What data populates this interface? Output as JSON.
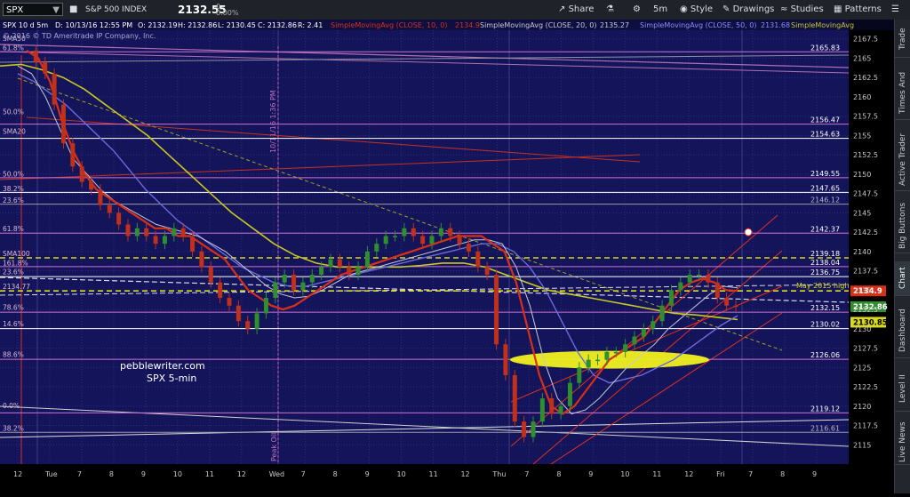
{
  "toolbar": {
    "symbol": "SPX",
    "description": "S&P 500 INDEX",
    "last_price": "2132.55",
    "change": "0",
    "change_pct": "0.00%",
    "share_label": "Share",
    "interval": "5m",
    "style_label": "Style",
    "drawings_label": "Drawings",
    "studies_label": "Studies",
    "patterns_label": "Patterns"
  },
  "side_tabs": [
    "Trade",
    "Times And Sales",
    "Active Trader",
    "Big Buttons",
    "Chart",
    "Dashboard",
    "Level II",
    "Live News"
  ],
  "side_active": "Chart",
  "header": {
    "line1_symbol": "SPX 10 d 5m",
    "line1_ohlc": "D: 10/13/16 12:55 PM",
    "open": "O: 2132.19",
    "high": "H: 2132.86",
    "low": "L: 2130.45",
    "close": "C: 2132.86",
    "range": "R: 2.41",
    "sma10": "SimpleMovingAvg (CLOSE, 10, 0)",
    "sma10_val": "2134.9",
    "sma20": "SimpleMovingAvg (CLOSE, 20, 0)",
    "sma20_val": "2135.27",
    "sma50": "SimpleMovingAvg (CLOSE, 50, 0)",
    "sma50_val": "2131.68",
    "sma100": "SimpleMovingAvg",
    "copyright": "© 2016 © TD Ameritrade IP Company, Inc."
  },
  "annotations": {
    "watermark1": "pebblewriter.com",
    "watermark2": "SPX 5-min",
    "peak_oil": "Peak Oil",
    "date_marker": "10/11/16 1:36 PM",
    "may_high": "May 2015 high"
  },
  "colors": {
    "background": "#14145a",
    "price_up": "#2f8f2f",
    "price_down": "#c0301a",
    "sma10": "#d83018",
    "sma20": "#c8c8d8",
    "sma50": "#6b6bdc",
    "sma100": "#c8c820",
    "fib": "#d070d0",
    "highlight": "#f0f020"
  },
  "chart_data": {
    "type": "line",
    "title": "SPX 10 d 5m",
    "ylim": [
      2112.5,
      2170
    ],
    "y_ticks": [
      "2167.5",
      "2165",
      "2162.5",
      "2160",
      "2157.5",
      "2155",
      "2152.5",
      "2150",
      "2147.5",
      "2145",
      "2142.5",
      "2140",
      "2137.5",
      "2135",
      "2132.5",
      "2130",
      "2127.5",
      "2125",
      "2122.5",
      "2120",
      "2117.5",
      "2115"
    ],
    "x_tick_labels": [
      "12",
      "Tue",
      "7",
      "8",
      "9",
      "10",
      "11",
      "12",
      "Wed",
      "7",
      "8",
      "9",
      "10",
      "11",
      "12",
      "Thu",
      "7",
      "8",
      "9",
      "10",
      "11",
      "12",
      "Fri",
      "7",
      "8",
      "9"
    ],
    "series": [
      {
        "name": "SimpleMovingAvg (CLOSE, 10, 0)",
        "color": "#d83018"
      },
      {
        "name": "SimpleMovingAvg (CLOSE, 20, 0)",
        "color": "#c8c8d8"
      },
      {
        "name": "SimpleMovingAvg (CLOSE, 50, 0)",
        "color": "#6b6bdc"
      },
      {
        "name": "SimpleMovingAvg",
        "color": "#c8c820"
      }
    ],
    "price_path": [
      2166,
      2164.5,
      2163,
      2159,
      2154,
      2151,
      2149,
      2148,
      2146,
      2145,
      2143.5,
      2142,
      2143,
      2142,
      2141,
      2142,
      2143,
      2142,
      2140,
      2138,
      2136,
      2134,
      2133,
      2131,
      2130,
      2132,
      2134,
      2136,
      2137,
      2135,
      2136,
      2137,
      2138,
      2139,
      2138,
      2137,
      2138,
      2140,
      2141,
      2142,
      2142,
      2143,
      2142,
      2141,
      2142,
      2143,
      2142,
      2141,
      2140,
      2138,
      2137,
      2128,
      2124,
      2118,
      2116,
      2118,
      2121,
      2119,
      2120,
      2123,
      2125,
      2126,
      2126,
      2127,
      2127,
      2128,
      2129,
      2130,
      2131,
      2133,
      2135,
      2136,
      2137,
      2137,
      2136,
      2134,
      2133,
      2132.9
    ],
    "sma10_path": [
      2166,
      2165,
      2162,
      2157,
      2153,
      2150,
      2148,
      2147,
      2146,
      2145,
      2144,
      2143,
      2143,
      2142,
      2142,
      2141,
      2140,
      2139,
      2137,
      2135,
      2134,
      2133,
      2132.5,
      2133,
      2134,
      2135,
      2136,
      2137,
      2137.5,
      2138,
      2138.5,
      2139,
      2139.5,
      2140,
      2140.5,
      2141,
      2141.5,
      2142,
      2142,
      2142,
      2141,
      2140,
      2136,
      2130,
      2124,
      2120,
      2119,
      2120,
      2122,
      2124,
      2126,
      2127,
      2128,
      2129,
      2131,
      2133,
      2135,
      2136,
      2136.5,
      2136,
      2135,
      2134.9
    ],
    "sma20_path": [
      2164,
      2163,
      2160,
      2156,
      2152,
      2150,
      2148,
      2146.5,
      2145.5,
      2144.5,
      2143.5,
      2143,
      2142.5,
      2142,
      2141,
      2140,
      2138.5,
      2137,
      2135.5,
      2134.5,
      2134,
      2134.2,
      2135,
      2136,
      2137,
      2137.5,
      2138,
      2138.5,
      2139,
      2139.5,
      2140,
      2140.5,
      2141,
      2141.5,
      2141.5,
      2141,
      2138,
      2133,
      2126,
      2121,
      2119,
      2119.5,
      2121,
      2123,
      2125,
      2126.5,
      2128,
      2130,
      2131.5,
      2133,
      2134.5,
      2135.5,
      2135.3
    ],
    "sma50_path": [
      2163,
      2162,
      2160.5,
      2159,
      2157,
      2155,
      2153,
      2150.5,
      2148,
      2146,
      2144,
      2142.5,
      2141,
      2139.5,
      2138,
      2137,
      2136,
      2135.5,
      2135.5,
      2136,
      2136.5,
      2137,
      2137.5,
      2138,
      2138.5,
      2139,
      2139.5,
      2140,
      2140.5,
      2141,
      2141,
      2140,
      2138,
      2135,
      2131,
      2127,
      2124,
      2123,
      2123.5,
      2124,
      2125,
      2126,
      2127.5,
      2129,
      2130.5,
      2131.7
    ],
    "sma100_path": [
      2164,
      2164.2,
      2163.5,
      2162.5,
      2161,
      2159,
      2157,
      2155,
      2152.5,
      2150,
      2147.5,
      2145,
      2143,
      2141,
      2139.5,
      2138.5,
      2138,
      2138,
      2138,
      2138,
      2138.2,
      2138.5,
      2138.5,
      2138,
      2137,
      2136,
      2135,
      2134.5,
      2134,
      2133.5,
      2133,
      2132.5,
      2132,
      2131.8,
      2131.5,
      2131.2
    ],
    "horizontal_levels": [
      {
        "label": "2165.83",
        "value": 2165.83,
        "color": "#d070d0"
      },
      {
        "label": "2156.47",
        "value": 2156.47,
        "color": "#d070d0"
      },
      {
        "label": "2154.63",
        "value": 2154.63,
        "color": "#ffffff"
      },
      {
        "label": "2149.55",
        "value": 2149.55,
        "color": "#d070d0"
      },
      {
        "label": "2147.65",
        "value": 2147.65,
        "color": "#ffffff"
      },
      {
        "label": "2146.12",
        "value": 2146.12,
        "color": "#9a9aa8"
      },
      {
        "label": "2142.37",
        "value": 2142.37,
        "color": "#d070d0"
      },
      {
        "label": "2139.18",
        "value": 2139.18,
        "color": "#d8d820"
      },
      {
        "label": "2138.04",
        "value": 2138.04,
        "color": "#d070d0"
      },
      {
        "label": "2136.75",
        "value": 2136.75,
        "color": "#ffffff"
      },
      {
        "label": "May 2015 high",
        "value": 2134.9,
        "color": "#d8d820"
      },
      {
        "label": "2132.15",
        "value": 2132.15,
        "color": "#d070d0"
      },
      {
        "label": "2130.02",
        "value": 2130.02,
        "color": "#ffffff"
      },
      {
        "label": "2126.06",
        "value": 2126.06,
        "color": "#d070d0"
      },
      {
        "label": "2119.12",
        "value": 2119.12,
        "color": "#d070d0"
      },
      {
        "label": "2116.61",
        "value": 2116.61,
        "color": "#9a9aa8"
      }
    ],
    "left_labels": [
      {
        "label": "SMA50",
        "value": 2167
      },
      {
        "label": "61.8%",
        "value": 2165.8
      },
      {
        "label": "50.0%",
        "value": 2157.5
      },
      {
        "label": "SMA20",
        "value": 2155
      },
      {
        "label": "50.0%",
        "value": 2149.5
      },
      {
        "label": "38.2%",
        "value": 2147.6
      },
      {
        "label": "23.6%",
        "value": 2146.1
      },
      {
        "label": "61.8%",
        "value": 2142.4
      },
      {
        "label": "SMA100",
        "value": 2139.2
      },
      {
        "label": "161.8%",
        "value": 2138
      },
      {
        "label": "23.6%",
        "value": 2136.8
      },
      {
        "label": "2134.77",
        "value": 2134.9
      },
      {
        "label": "78.6%",
        "value": 2132.2
      },
      {
        "label": "14.6%",
        "value": 2130.1
      },
      {
        "label": "88.6%",
        "value": 2126.1
      },
      {
        "label": "0.0%",
        "value": 2119.5
      },
      {
        "label": "38.2%",
        "value": 2116.6
      }
    ],
    "price_tags": [
      {
        "label": "2134.9",
        "value": 2134.9,
        "color": "#d83018"
      },
      {
        "label": "2132.86",
        "value": 2132.86,
        "color": "#2f8f2f"
      },
      {
        "label": "2130.85",
        "value": 2130.85,
        "color": "#d8d820"
      }
    ]
  }
}
